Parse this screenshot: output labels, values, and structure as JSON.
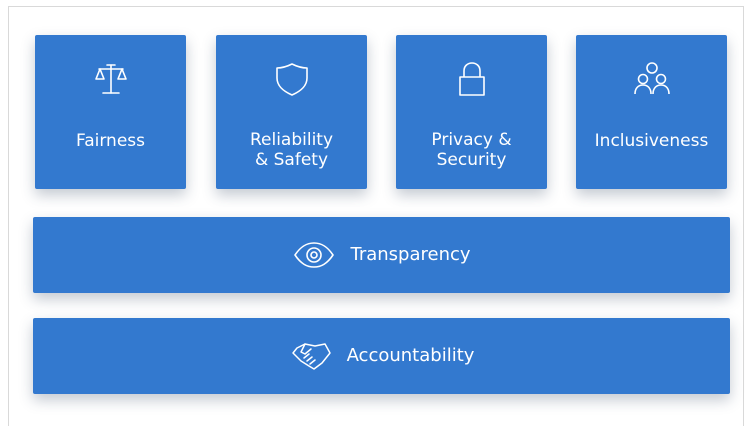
{
  "pillars": [
    {
      "label": "Fairness",
      "icon": "scales-icon"
    },
    {
      "label": "Reliability\n& Safety",
      "icon": "shield-icon"
    },
    {
      "label": "Privacy &\nSecurity",
      "icon": "lock-icon"
    },
    {
      "label": "Inclusiveness",
      "icon": "people-icon"
    }
  ],
  "foundations": [
    {
      "label": "Transparency",
      "icon": "eye-icon"
    },
    {
      "label": "Accountability",
      "icon": "handshake-icon"
    }
  ],
  "colors": {
    "tile": "#3379cf",
    "text": "#ffffff",
    "frame_border": "#d9d9d9"
  }
}
